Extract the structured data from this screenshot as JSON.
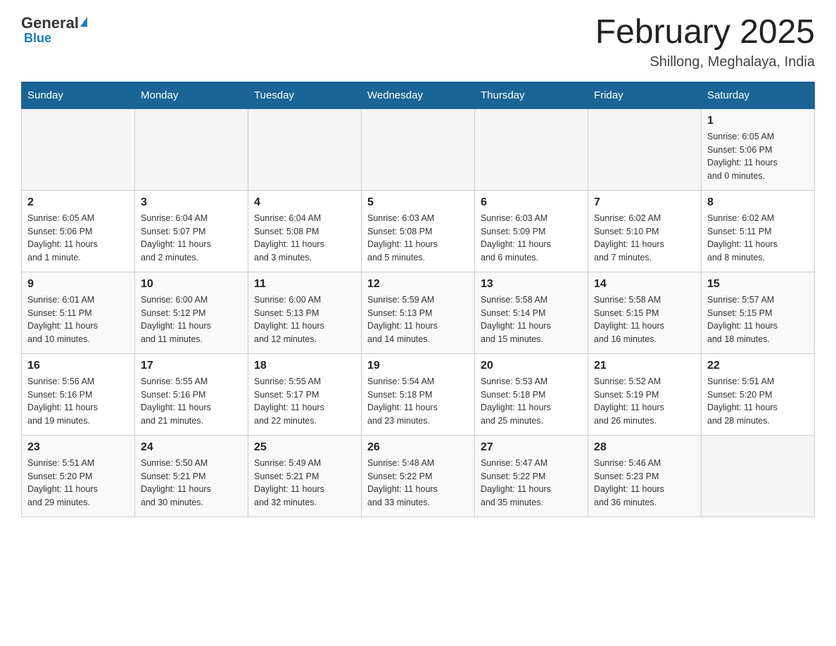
{
  "header": {
    "logo_general": "General",
    "logo_blue": "Blue",
    "month_title": "February 2025",
    "location": "Shillong, Meghalaya, India"
  },
  "weekdays": [
    "Sunday",
    "Monday",
    "Tuesday",
    "Wednesday",
    "Thursday",
    "Friday",
    "Saturday"
  ],
  "weeks": [
    {
      "days": [
        {
          "num": "",
          "info": ""
        },
        {
          "num": "",
          "info": ""
        },
        {
          "num": "",
          "info": ""
        },
        {
          "num": "",
          "info": ""
        },
        {
          "num": "",
          "info": ""
        },
        {
          "num": "",
          "info": ""
        },
        {
          "num": "1",
          "info": "Sunrise: 6:05 AM\nSunset: 5:06 PM\nDaylight: 11 hours\nand 0 minutes."
        }
      ]
    },
    {
      "days": [
        {
          "num": "2",
          "info": "Sunrise: 6:05 AM\nSunset: 5:06 PM\nDaylight: 11 hours\nand 1 minute."
        },
        {
          "num": "3",
          "info": "Sunrise: 6:04 AM\nSunset: 5:07 PM\nDaylight: 11 hours\nand 2 minutes."
        },
        {
          "num": "4",
          "info": "Sunrise: 6:04 AM\nSunset: 5:08 PM\nDaylight: 11 hours\nand 3 minutes."
        },
        {
          "num": "5",
          "info": "Sunrise: 6:03 AM\nSunset: 5:08 PM\nDaylight: 11 hours\nand 5 minutes."
        },
        {
          "num": "6",
          "info": "Sunrise: 6:03 AM\nSunset: 5:09 PM\nDaylight: 11 hours\nand 6 minutes."
        },
        {
          "num": "7",
          "info": "Sunrise: 6:02 AM\nSunset: 5:10 PM\nDaylight: 11 hours\nand 7 minutes."
        },
        {
          "num": "8",
          "info": "Sunrise: 6:02 AM\nSunset: 5:11 PM\nDaylight: 11 hours\nand 8 minutes."
        }
      ]
    },
    {
      "days": [
        {
          "num": "9",
          "info": "Sunrise: 6:01 AM\nSunset: 5:11 PM\nDaylight: 11 hours\nand 10 minutes."
        },
        {
          "num": "10",
          "info": "Sunrise: 6:00 AM\nSunset: 5:12 PM\nDaylight: 11 hours\nand 11 minutes."
        },
        {
          "num": "11",
          "info": "Sunrise: 6:00 AM\nSunset: 5:13 PM\nDaylight: 11 hours\nand 12 minutes."
        },
        {
          "num": "12",
          "info": "Sunrise: 5:59 AM\nSunset: 5:13 PM\nDaylight: 11 hours\nand 14 minutes."
        },
        {
          "num": "13",
          "info": "Sunrise: 5:58 AM\nSunset: 5:14 PM\nDaylight: 11 hours\nand 15 minutes."
        },
        {
          "num": "14",
          "info": "Sunrise: 5:58 AM\nSunset: 5:15 PM\nDaylight: 11 hours\nand 16 minutes."
        },
        {
          "num": "15",
          "info": "Sunrise: 5:57 AM\nSunset: 5:15 PM\nDaylight: 11 hours\nand 18 minutes."
        }
      ]
    },
    {
      "days": [
        {
          "num": "16",
          "info": "Sunrise: 5:56 AM\nSunset: 5:16 PM\nDaylight: 11 hours\nand 19 minutes."
        },
        {
          "num": "17",
          "info": "Sunrise: 5:55 AM\nSunset: 5:16 PM\nDaylight: 11 hours\nand 21 minutes."
        },
        {
          "num": "18",
          "info": "Sunrise: 5:55 AM\nSunset: 5:17 PM\nDaylight: 11 hours\nand 22 minutes."
        },
        {
          "num": "19",
          "info": "Sunrise: 5:54 AM\nSunset: 5:18 PM\nDaylight: 11 hours\nand 23 minutes."
        },
        {
          "num": "20",
          "info": "Sunrise: 5:53 AM\nSunset: 5:18 PM\nDaylight: 11 hours\nand 25 minutes."
        },
        {
          "num": "21",
          "info": "Sunrise: 5:52 AM\nSunset: 5:19 PM\nDaylight: 11 hours\nand 26 minutes."
        },
        {
          "num": "22",
          "info": "Sunrise: 5:51 AM\nSunset: 5:20 PM\nDaylight: 11 hours\nand 28 minutes."
        }
      ]
    },
    {
      "days": [
        {
          "num": "23",
          "info": "Sunrise: 5:51 AM\nSunset: 5:20 PM\nDaylight: 11 hours\nand 29 minutes."
        },
        {
          "num": "24",
          "info": "Sunrise: 5:50 AM\nSunset: 5:21 PM\nDaylight: 11 hours\nand 30 minutes."
        },
        {
          "num": "25",
          "info": "Sunrise: 5:49 AM\nSunset: 5:21 PM\nDaylight: 11 hours\nand 32 minutes."
        },
        {
          "num": "26",
          "info": "Sunrise: 5:48 AM\nSunset: 5:22 PM\nDaylight: 11 hours\nand 33 minutes."
        },
        {
          "num": "27",
          "info": "Sunrise: 5:47 AM\nSunset: 5:22 PM\nDaylight: 11 hours\nand 35 minutes."
        },
        {
          "num": "28",
          "info": "Sunrise: 5:46 AM\nSunset: 5:23 PM\nDaylight: 11 hours\nand 36 minutes."
        },
        {
          "num": "",
          "info": ""
        }
      ]
    }
  ]
}
